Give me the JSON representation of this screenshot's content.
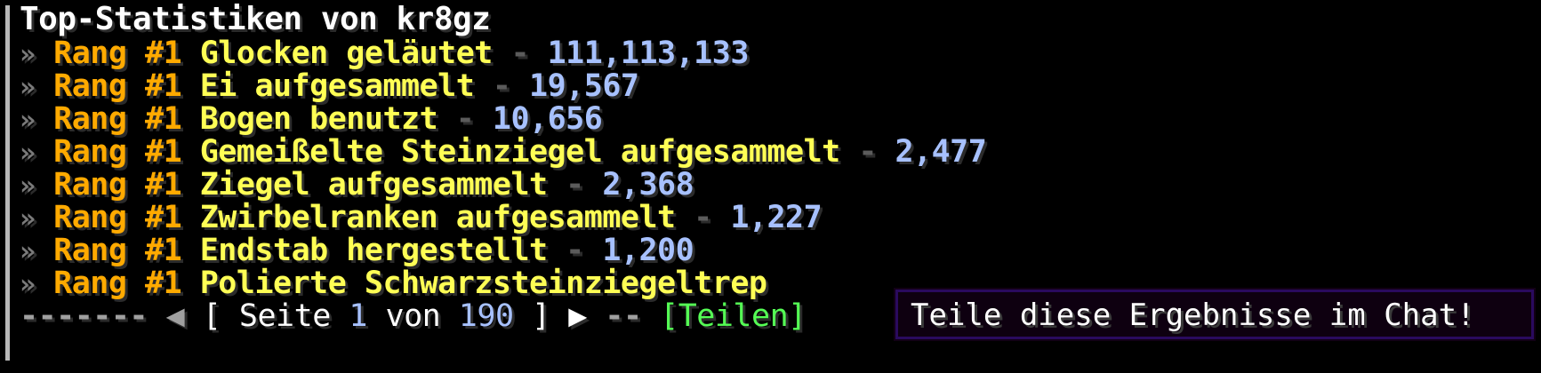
{
  "title": "Top-Statistiken von kr8gz",
  "rank_label": "Rang #1",
  "separator": " - ",
  "bullet": "»",
  "entries": [
    {
      "stat": "Glocken geläutet",
      "value": "111,113,133"
    },
    {
      "stat": "Ei aufgesammelt",
      "value": "19,567"
    },
    {
      "stat": "Bogen benutzt",
      "value": "10,656"
    },
    {
      "stat": "Gemeißelte Steinziegel aufgesammelt",
      "value": "2,477"
    },
    {
      "stat": "Ziegel aufgesammelt",
      "value": "2,368"
    },
    {
      "stat": "Zwirbelranken aufgesammelt",
      "value": "1,227"
    },
    {
      "stat": "Endstab hergestellt",
      "value": "1,200"
    },
    {
      "stat": "Polierte Schwarzsteinziegeltrep",
      "value": ""
    }
  ],
  "pager": {
    "dashes_left": "-------",
    "prev": "◀",
    "open": "[",
    "page_word": "Seite",
    "current": "1",
    "of_word": "von",
    "total": "190",
    "close": "]",
    "next": "▶",
    "dashes_right": "--",
    "share": "[Teilen]"
  },
  "tooltip": {
    "text": "Teile diese Ergebnisse im Chat!"
  },
  "colors": {
    "rank": "#ffaa00",
    "stat": "#ffff55",
    "value": "#a7c1ff",
    "share": "#55ff55",
    "tooltip_border": "#2a0a5e"
  }
}
